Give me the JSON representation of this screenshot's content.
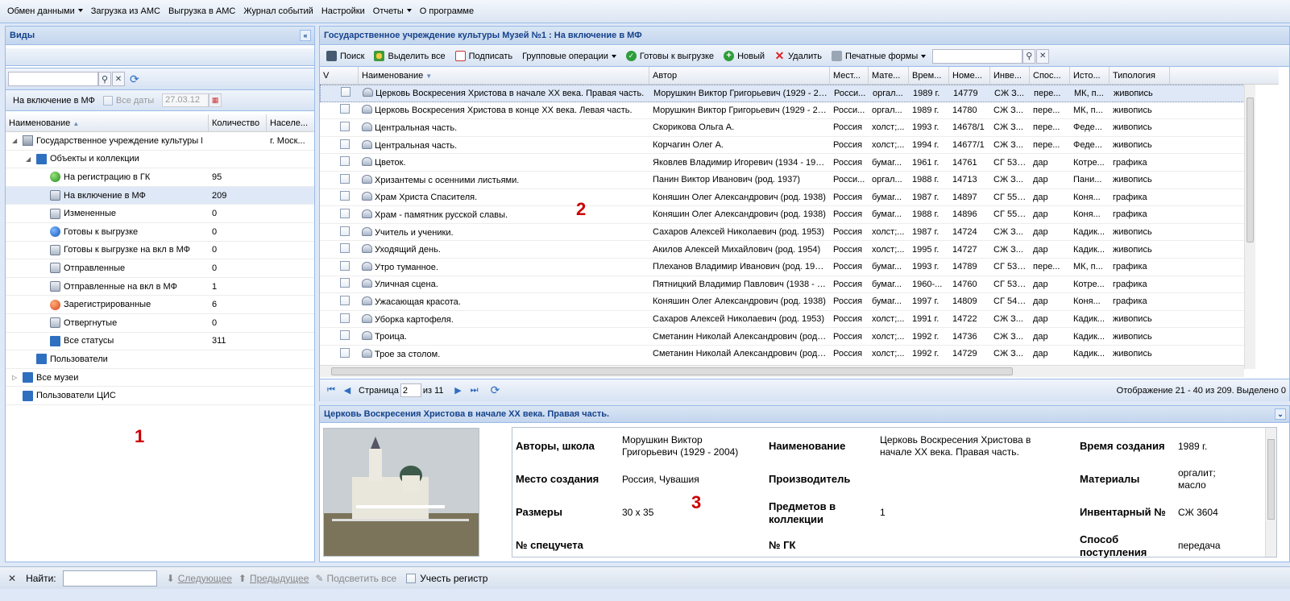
{
  "menu": [
    "Обмен данными",
    "Загрузка из АМС",
    "Выгрузка в АМС",
    "Журнал событий",
    "Настройки",
    "Отчеты",
    "О программе"
  ],
  "left": {
    "title": "Виды",
    "filter_label": "На включение в МФ",
    "all_dates_label": "Все даты",
    "date_value": "27.03.12",
    "columns": [
      "Наименование",
      "Количество",
      "Населе..."
    ],
    "tree": [
      {
        "label": "Государственное учреждение культуры Му",
        "count": "",
        "city": "г. Моск...",
        "level": 0,
        "icon": "museum-icon",
        "expander": "expanded"
      },
      {
        "label": "Объекты и коллекции",
        "count": "",
        "city": "",
        "level": 1,
        "icon": "book-icon",
        "expander": "expanded"
      },
      {
        "label": "На регистрацию в ГК",
        "count": "95",
        "city": "",
        "level": 2,
        "icon": "green-dot-icon"
      },
      {
        "label": "На включение в МФ",
        "count": "209",
        "city": "",
        "level": 2,
        "icon": "database-icon",
        "selected": true
      },
      {
        "label": "Измененные",
        "count": "0",
        "city": "",
        "level": 2,
        "icon": "database-icon"
      },
      {
        "label": "Готовы к выгрузке",
        "count": "0",
        "city": "",
        "level": 2,
        "icon": "blue-dot-icon"
      },
      {
        "label": "Готовы к выгрузке на вкл в МФ",
        "count": "0",
        "city": "",
        "level": 2,
        "icon": "database-icon"
      },
      {
        "label": "Отправленные",
        "count": "0",
        "city": "",
        "level": 2,
        "icon": "database-icon"
      },
      {
        "label": "Отправленные на вкл в МФ",
        "count": "1",
        "city": "",
        "level": 2,
        "icon": "database-icon"
      },
      {
        "label": "Зарегистрированные",
        "count": "6",
        "city": "",
        "level": 2,
        "icon": "orange-dot-icon"
      },
      {
        "label": "Отвергнутые",
        "count": "0",
        "city": "",
        "level": 2,
        "icon": "database-icon"
      },
      {
        "label": "Все статусы",
        "count": "311",
        "city": "",
        "level": 2,
        "icon": "book-icon"
      },
      {
        "label": "Пользователи",
        "count": "",
        "city": "",
        "level": 1,
        "icon": "book-icon"
      },
      {
        "label": "Все музеи",
        "count": "",
        "city": "",
        "level": 0,
        "icon": "book-icon",
        "expander": "collapsed"
      },
      {
        "label": "Пользователи ЦИС",
        "count": "",
        "city": "",
        "level": 0,
        "icon": "book-icon"
      }
    ],
    "marker": "1"
  },
  "main": {
    "title": "Государственное учреждение культуры Музей №1 : На включение в МФ",
    "toolbar": {
      "search": "Поиск",
      "select_all": "Выделить все",
      "sign": "Подписать",
      "group_ops": "Групповые операции",
      "ready": "Готовы к выгрузке",
      "new": "Новый",
      "delete": "Удалить",
      "print": "Печатные формы"
    },
    "columns": [
      "V",
      "Наименование",
      "Автор",
      "Мест...",
      "Мате...",
      "Врем...",
      "Номе...",
      "Инве...",
      "Спос...",
      "Исто...",
      "Типология"
    ],
    "rows": [
      [
        "Церковь Воскресения Христова в начале XX века. Правая часть.",
        "Морушкин Виктор Григорьевич (1929 - 20...",
        "Росси...",
        "оргал...",
        "1989 г.",
        "14779",
        "СЖ З...",
        "пере...",
        "МК, п...",
        "живопись"
      ],
      [
        "Церковь Воскресения Христова в конце XX века. Левая часть.",
        "Морушкин Виктор Григорьевич (1929 - 20...",
        "Росси...",
        "оргал...",
        "1989 г.",
        "14780",
        "СЖ З...",
        "пере...",
        "МК, п...",
        "живопись"
      ],
      [
        "Центральная часть.",
        "Скорикова Ольга А.",
        "Россия",
        "холст;...",
        "1993 г.",
        "14678/1",
        "СЖ З...",
        "пере...",
        "Феде...",
        "живопись"
      ],
      [
        "Центральная часть.",
        "Корчагин Олег А.",
        "Россия",
        "холст;...",
        "1994 г.",
        "14677/1",
        "СЖ З...",
        "пере...",
        "Феде...",
        "живопись"
      ],
      [
        "Цветок.",
        "Яковлев Владимир Игоревич (1934 - 199...",
        "Россия",
        "бумаг...",
        "1961 г.",
        "14761",
        "СГ 5360",
        "дар",
        "Котре...",
        "графика"
      ],
      [
        "Хризантемы с осенними листьями.",
        "Панин Виктор Иванович (род. 1937)",
        "Росси...",
        "оргал...",
        "1988 г.",
        "14713",
        "СЖ З...",
        "дар",
        "Пани...",
        "живопись"
      ],
      [
        "Храм Христа Спасителя.",
        "Коняшин Олег Александрович (род. 1938)",
        "Россия",
        "бумаг...",
        "1987 г.",
        "14897",
        "СГ 5539",
        "дар",
        "Коня...",
        "графика"
      ],
      [
        "Храм - памятник русской славы.",
        "Коняшин Олег Александрович (род. 1938)",
        "Россия",
        "бумаг...",
        "1988 г.",
        "14896",
        "СГ 5538",
        "дар",
        "Коня...",
        "графика"
      ],
      [
        "Учитель и ученики.",
        "Сахаров Алексей Николаевич (род. 1953)",
        "Россия",
        "холст;...",
        "1987 г.",
        "14724",
        "СЖ З...",
        "дар",
        "Кадик...",
        "живопись"
      ],
      [
        "Уходящий день.",
        "Акилов Алексей Михайлович (род. 1954)",
        "Россия",
        "холст;...",
        "1995 г.",
        "14727",
        "СЖ З...",
        "дар",
        "Кадик...",
        "живопись"
      ],
      [
        "Утро туманное.",
        "Плеханов Владимир Иванович (род. 1938)",
        "Россия",
        "бумаг...",
        "1993 г.",
        "14789",
        "СГ 5365",
        "пере...",
        "МК, п...",
        "графика"
      ],
      [
        "Уличная сцена.",
        "Пятницкий Владимир Павлович (1938 - 1...",
        "Россия",
        "бумаг...",
        "1960-...",
        "14760",
        "СГ 5359",
        "дар",
        "Котре...",
        "графика"
      ],
      [
        "Ужасающая красота.",
        "Коняшин Олег Александрович (род. 1938)",
        "Россия",
        "бумаг...",
        "1997 г.",
        "14809",
        "СГ 5451",
        "дар",
        "Коня...",
        "графика"
      ],
      [
        "Уборка картофеля.",
        "Сахаров Алексей Николаевич (род. 1953)",
        "Россия",
        "холст;...",
        "1991 г.",
        "14722",
        "СЖ З...",
        "дар",
        "Кадик...",
        "живопись"
      ],
      [
        "Троица.",
        "Сметанин Николай Александрович (род. ...",
        "Россия",
        "холст;...",
        "1992 г.",
        "14736",
        "СЖ З...",
        "дар",
        "Кадик...",
        "живопись"
      ],
      [
        "Трое за столом.",
        "Сметанин Николай Александрович (род. ...",
        "Россия",
        "холст;...",
        "1992 г.",
        "14729",
        "СЖ З...",
        "дар",
        "Кадик...",
        "живопись"
      ]
    ],
    "paging": {
      "page_label": "Страница",
      "page": "2",
      "of_label": "из 11",
      "status": "Отображение 21 - 40 из 209. Выделено 0"
    },
    "marker": "2"
  },
  "detail": {
    "title": "Церковь Воскресения Христова в начале XX века. Правая часть.",
    "fields": {
      "authors_label": "Авторы, школа",
      "authors": "Морушкин Виктор Григорьевич (1929 - 2004)",
      "name_label": "Наименование",
      "name": "Церковь Воскресения Христова в начале XX века. Правая часть.",
      "time_label": "Время создания",
      "time": "1989 г.",
      "place_label": "Место создания",
      "place": "Россия, Чувашия",
      "producer_label": "Производитель",
      "producer": "",
      "materials_label": "Материалы",
      "materials": "оргалит; масло",
      "size_label": "Размеры",
      "size": "30 х 35",
      "items_label": "Предметов в коллекции",
      "items": "1",
      "inv_label": "Инвентарный №",
      "inv": "СЖ 3604",
      "special_label": "№ спецучета",
      "special": "",
      "gk_label": "№ ГК",
      "gk": "",
      "method_label": "Способ поступления",
      "method": "передача"
    },
    "marker": "3"
  },
  "findbar": {
    "label": "Найти:",
    "next": "Следующее",
    "prev": "Предыдущее",
    "highlight": "Подсветить все",
    "case": "Учесть регистр"
  }
}
